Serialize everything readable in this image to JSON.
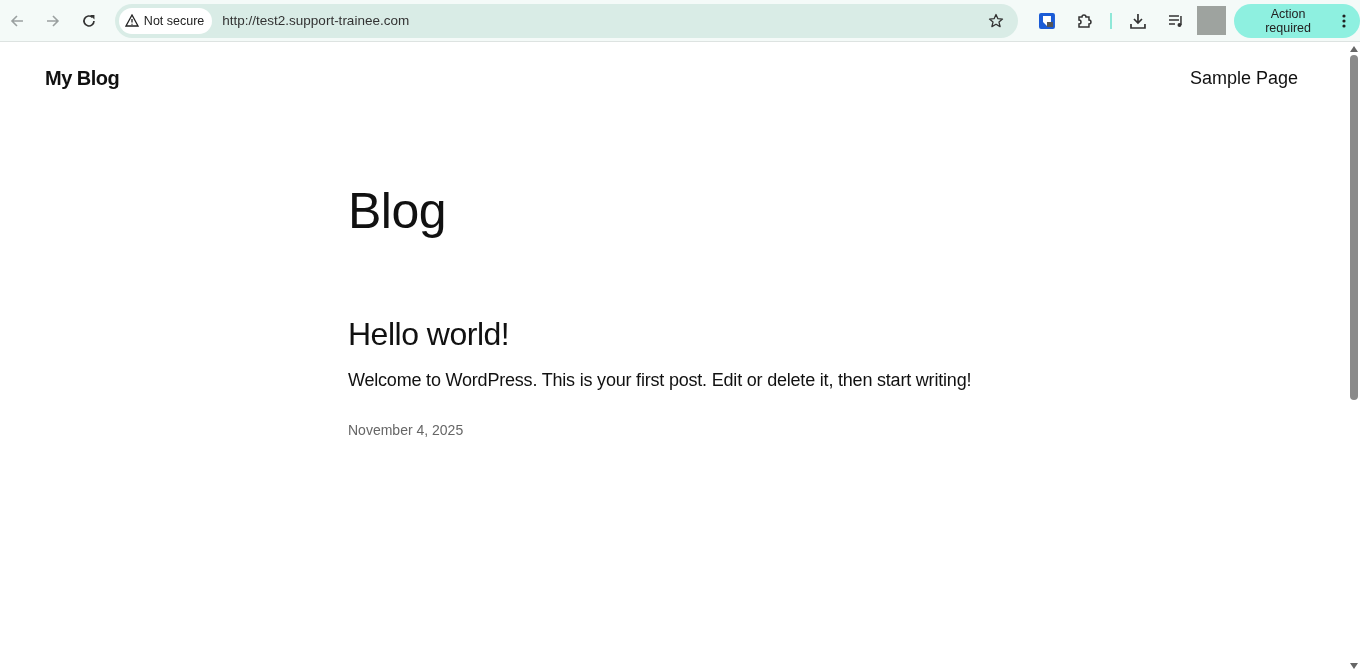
{
  "browser": {
    "security_label": "Not secure",
    "url": "http://test2.support-trainee.com",
    "action_button": "Action required"
  },
  "site": {
    "title": "My Blog",
    "nav": [
      "Sample Page"
    ]
  },
  "page_title": "Blog",
  "posts": [
    {
      "title": "Hello world!",
      "excerpt": "Welcome to WordPress. This is your first post. Edit or delete it, then start writing!",
      "date": "November 4, 2025"
    }
  ]
}
